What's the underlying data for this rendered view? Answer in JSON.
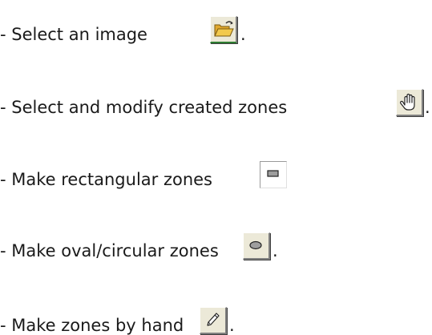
{
  "items": [
    {
      "label": "- Select an image",
      "icon": "open-folder-icon",
      "suffix": "."
    },
    {
      "label": "- Select and modify created zones",
      "icon": "hand-icon",
      "suffix": "."
    },
    {
      "label": "- Make rectangular zones",
      "icon": "rectangle-zone-icon",
      "suffix": ""
    },
    {
      "label": "- Make oval/circular zones",
      "icon": "oval-zone-icon",
      "suffix": "."
    },
    {
      "label": "- Make zones by hand",
      "icon": "pencil-icon",
      "suffix": "."
    }
  ],
  "colors": {
    "button_face": "#ece9d8",
    "folder": "#f2c94c",
    "shape_fill": "#9e9e9e"
  }
}
